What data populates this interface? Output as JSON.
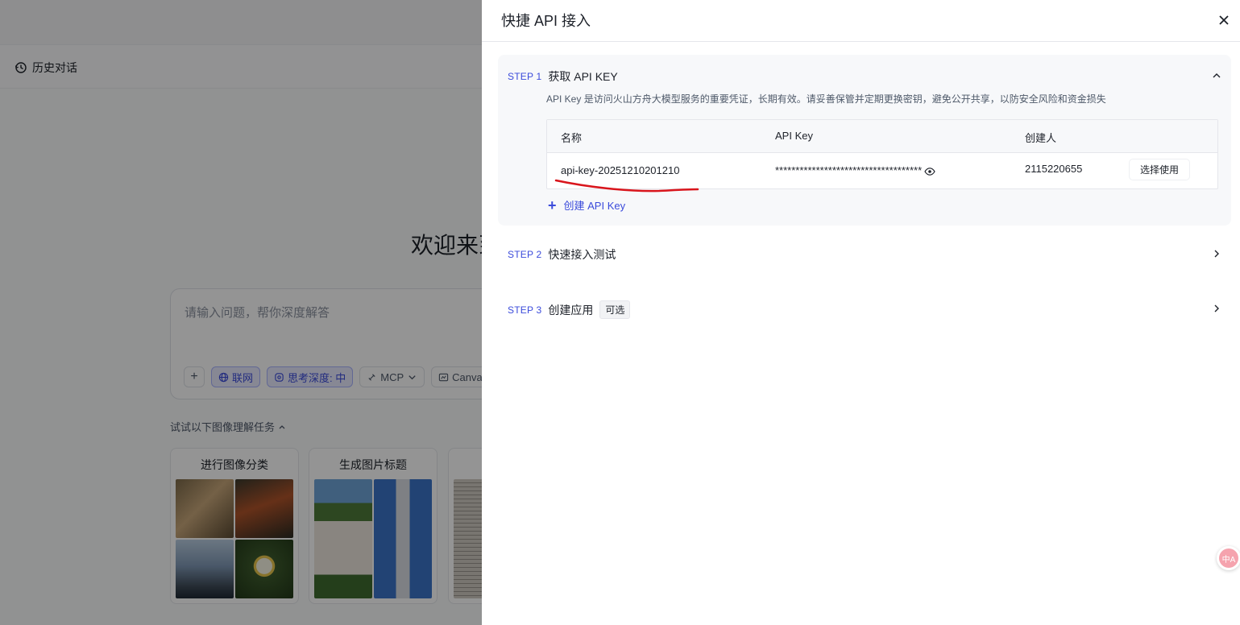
{
  "background": {
    "history_label": "历史对话",
    "welcome_text": "欢迎来到",
    "chat_placeholder": "请输入问题，帮你深度解答",
    "tools": {
      "add_label": "+",
      "web_label": "联网",
      "think_label": "思考深度: 中",
      "mcp_label": "MCP",
      "canvas_label": "Canvas"
    },
    "try_label": "试试以下图像理解任务",
    "cards": [
      {
        "title": "进行图像分类"
      },
      {
        "title": "生成图片标题"
      },
      {
        "title": ""
      }
    ]
  },
  "drawer": {
    "title": "快捷 API 接入",
    "step1": {
      "tag": "STEP 1",
      "name": "获取 API KEY",
      "description": "API Key 是访问火山方舟大模型服务的重要凭证，长期有效。请妥善保管并定期更换密钥，避免公开共享，以防安全风险和资金损失",
      "table": {
        "headers": [
          "名称",
          "API Key",
          "创建人"
        ],
        "rows": [
          {
            "name": "api-key-20251210201210",
            "key": "************************************",
            "creator": "2115220655",
            "action": "选择使用"
          }
        ]
      },
      "create_label": "创建 API Key"
    },
    "step2": {
      "tag": "STEP 2",
      "name": "快速接入测试"
    },
    "step3": {
      "tag": "STEP 3",
      "name": "创建应用",
      "badge": "可选"
    }
  },
  "floating": {
    "translate_icon_text": "中A"
  },
  "colors": {
    "accent": "#3b4bdb",
    "annotation_red": "#d9151c"
  }
}
